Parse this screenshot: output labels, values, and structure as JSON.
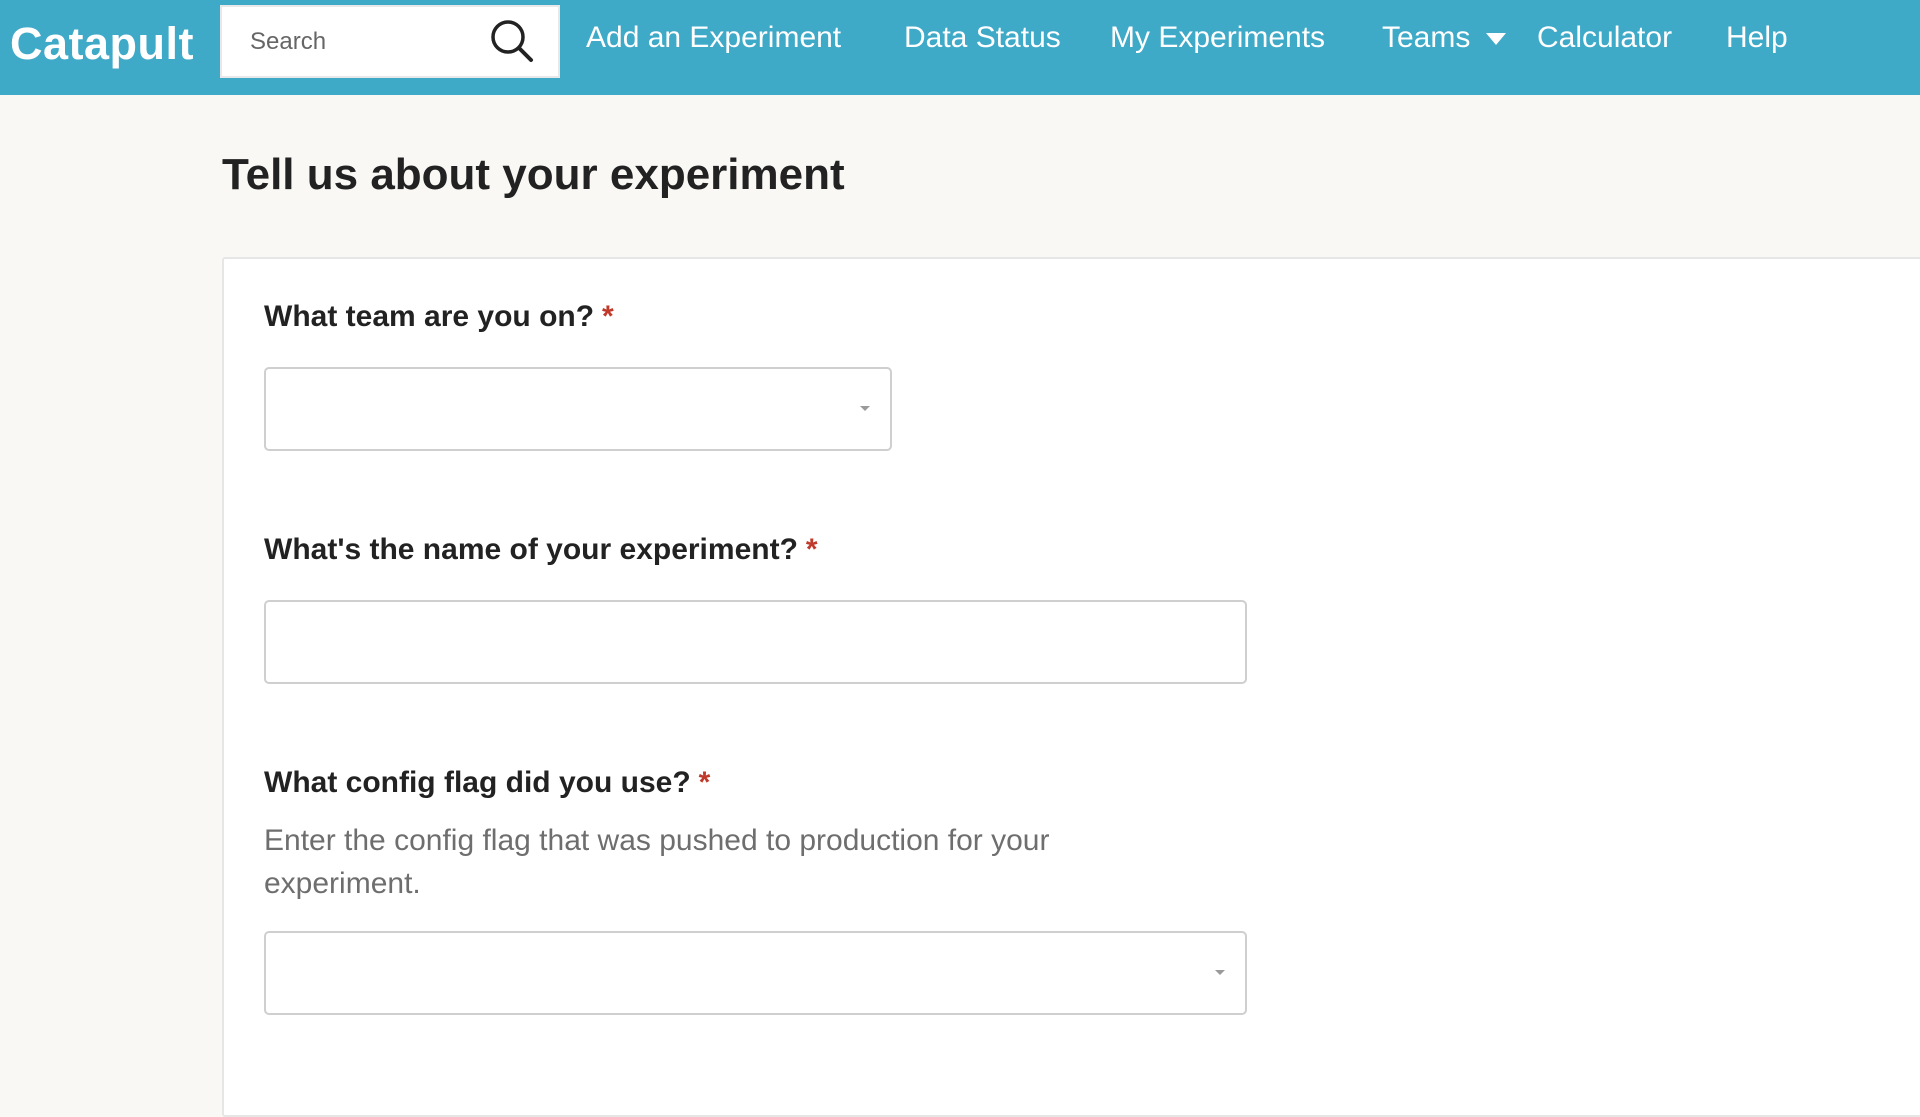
{
  "app": {
    "name": "Catapult"
  },
  "search": {
    "placeholder": "Search"
  },
  "nav": {
    "add_experiment": "Add an Experiment",
    "data_status": "Data Status",
    "my_experiments": "My Experiments",
    "teams": "Teams",
    "calculator": "Calculator",
    "help": "Help"
  },
  "page": {
    "title": "Tell us about your experiment"
  },
  "form": {
    "required_marker": "*",
    "team": {
      "label": "What team are you on?",
      "value": ""
    },
    "name": {
      "label": "What's the name of your experiment?",
      "value": ""
    },
    "config_flag": {
      "label": "What config flag did you use?",
      "helper": "Enter the config flag that was pushed to production for your experiment.",
      "value": ""
    }
  },
  "colors": {
    "header_bg": "#3fa9c8",
    "page_bg": "#f9f8f5",
    "required": "#c0392b"
  },
  "icons": {
    "search": "magnifying-glass-icon",
    "dropdown": "caret-down-icon"
  }
}
